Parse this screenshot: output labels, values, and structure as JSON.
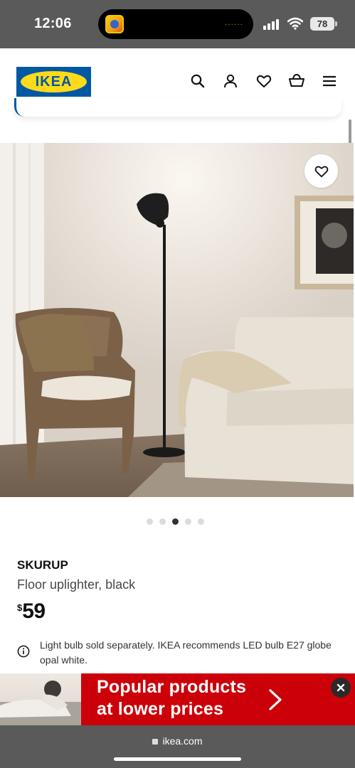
{
  "status_bar": {
    "time": "12:06",
    "battery": "78",
    "island_dots": "......"
  },
  "header": {
    "logo_text": "IKEA",
    "icons": [
      "search-icon",
      "profile-icon",
      "heart-icon",
      "cart-icon",
      "menu-icon"
    ]
  },
  "carousel": {
    "count": 5,
    "active_index": 2
  },
  "product": {
    "name": "SKURUP",
    "description": "Floor uplighter, black",
    "price_currency": "$",
    "price_amount": "59",
    "info": "Light bulb sold separately. IKEA recommends LED bulb E27 globe opal white."
  },
  "promo": {
    "line1": "Popular products",
    "line2": "at lower prices"
  },
  "browser": {
    "url": "ikea.com"
  },
  "colors": {
    "ikea_blue": "#0058a3",
    "ikea_yellow": "#ffda1a",
    "promo_red": "#cc0008"
  }
}
